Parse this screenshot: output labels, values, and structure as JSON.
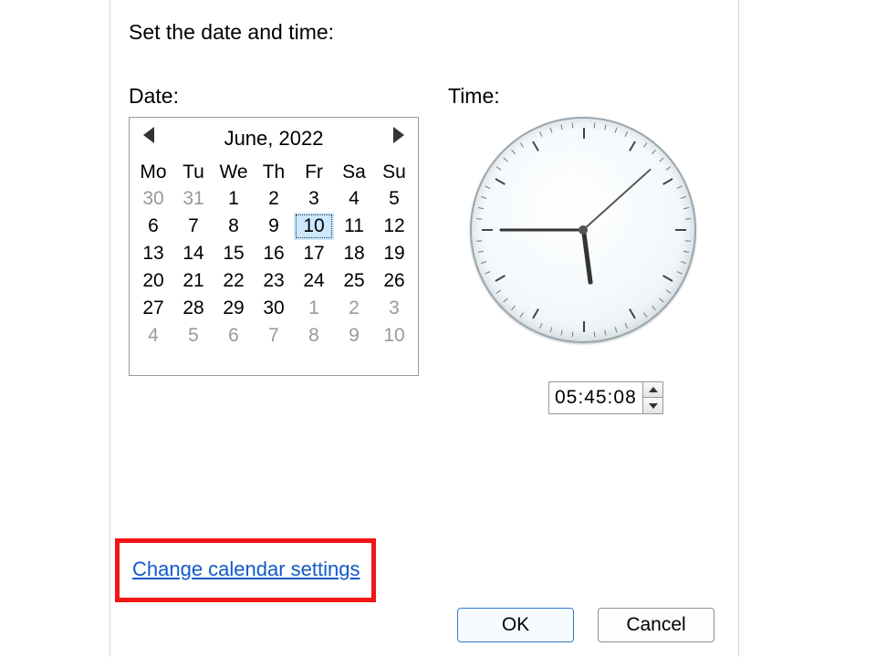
{
  "heading": "Set the date and time:",
  "date_label": "Date:",
  "time_label": "Time:",
  "calendar": {
    "month_label": "June, 2022",
    "weekdays": [
      "Mo",
      "Tu",
      "We",
      "Th",
      "Fr",
      "Sa",
      "Su"
    ],
    "rows": [
      [
        {
          "n": 30,
          "out": true
        },
        {
          "n": 31,
          "out": true
        },
        {
          "n": 1
        },
        {
          "n": 2
        },
        {
          "n": 3
        },
        {
          "n": 4
        },
        {
          "n": 5
        }
      ],
      [
        {
          "n": 6
        },
        {
          "n": 7
        },
        {
          "n": 8
        },
        {
          "n": 9
        },
        {
          "n": 10,
          "sel": true
        },
        {
          "n": 11
        },
        {
          "n": 12
        }
      ],
      [
        {
          "n": 13
        },
        {
          "n": 14
        },
        {
          "n": 15
        },
        {
          "n": 16
        },
        {
          "n": 17
        },
        {
          "n": 18
        },
        {
          "n": 19
        }
      ],
      [
        {
          "n": 20
        },
        {
          "n": 21
        },
        {
          "n": 22
        },
        {
          "n": 23
        },
        {
          "n": 24
        },
        {
          "n": 25
        },
        {
          "n": 26
        }
      ],
      [
        {
          "n": 27
        },
        {
          "n": 28
        },
        {
          "n": 29
        },
        {
          "n": 30
        },
        {
          "n": 1,
          "out": true
        },
        {
          "n": 2,
          "out": true
        },
        {
          "n": 3,
          "out": true
        }
      ],
      [
        {
          "n": 4,
          "out": true
        },
        {
          "n": 5,
          "out": true
        },
        {
          "n": 6,
          "out": true
        },
        {
          "n": 7,
          "out": true
        },
        {
          "n": 8,
          "out": true
        },
        {
          "n": 9,
          "out": true
        },
        {
          "n": 10,
          "out": true
        }
      ]
    ]
  },
  "time": {
    "display": "05:45:08",
    "h": 5,
    "m": 45,
    "s": 8
  },
  "link_text": "Change calendar settings",
  "buttons": {
    "ok": "OK",
    "cancel": "Cancel"
  },
  "colors": {
    "annotation": "#f31515",
    "link": "#1059c9",
    "selected_bg": "#cce8ff"
  }
}
